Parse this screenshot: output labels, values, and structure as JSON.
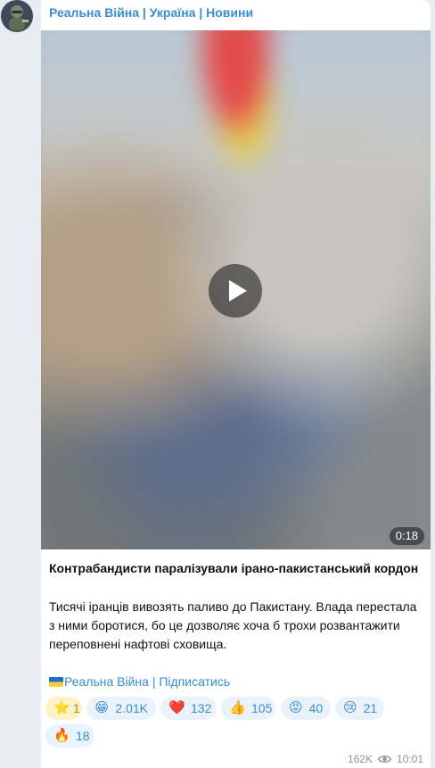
{
  "channel": {
    "title": "Реальна Війна | Україна | Новини"
  },
  "video": {
    "duration": "0:18"
  },
  "post": {
    "title": "Контрабандисти паралізували ірано-пакистанський кордон",
    "body": "Тисячі іранців вивозять паливо до Пакистану. Влада перестала з ними боротися, бо це дозволяє хоча б трохи розвантажити переповнені нафтові сховища.",
    "link_text": "Реальна Війна | Підписатись"
  },
  "reactions": [
    {
      "icon": "⭐",
      "count": "1",
      "name": "star"
    },
    {
      "icon": "😁",
      "count": "2.01K",
      "name": "grin"
    },
    {
      "icon": "❤️",
      "count": "132",
      "name": "heart"
    },
    {
      "icon": "👍",
      "count": "105",
      "name": "thumbs-up"
    },
    {
      "icon": "😡",
      "count": "40",
      "name": "angry"
    },
    {
      "icon": "😢",
      "count": "21",
      "name": "cry"
    },
    {
      "icon": "🔥",
      "count": "18",
      "name": "fire"
    }
  ],
  "footer": {
    "views": "162K",
    "time": "10:01"
  },
  "colors": {
    "accent": "#3b8bcf",
    "reaction_bg": "#eaf3fb",
    "paid_bg": "#fff2c9"
  }
}
